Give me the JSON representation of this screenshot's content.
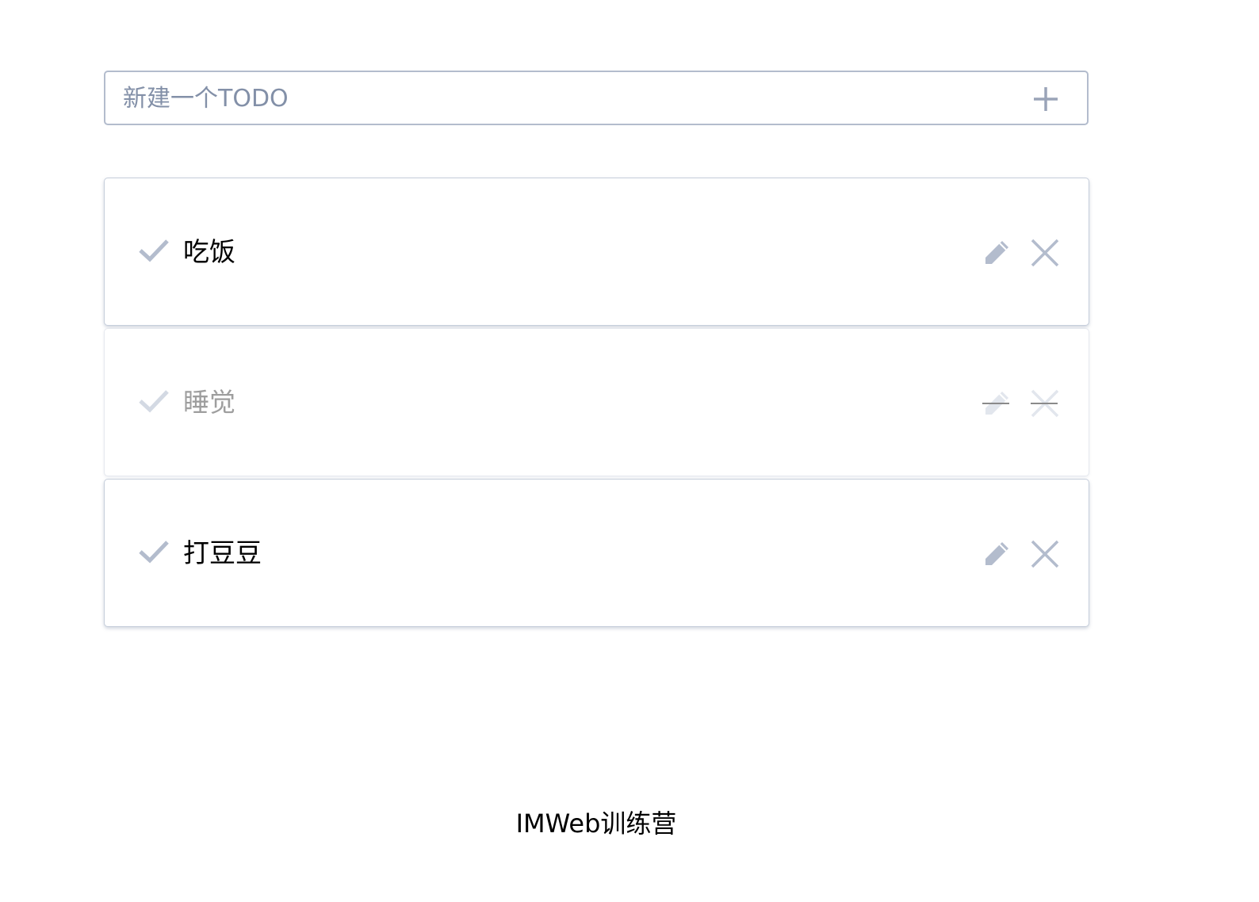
{
  "new_todo": {
    "placeholder": "新建一个TODO",
    "value": "",
    "add_icon": "plus-icon"
  },
  "todos": [
    {
      "text": "吃饭",
      "done": false
    },
    {
      "text": "睡觉",
      "done": true
    },
    {
      "text": "打豆豆",
      "done": false
    }
  ],
  "footer": {
    "text": "IMWeb训练营"
  },
  "colors": {
    "border": "#b3bccd",
    "icon": "#b3bccd",
    "icon_done": "#dfe3ea",
    "placeholder": "#8390a8",
    "text": "#000000",
    "text_done": "#9e9e9e"
  }
}
